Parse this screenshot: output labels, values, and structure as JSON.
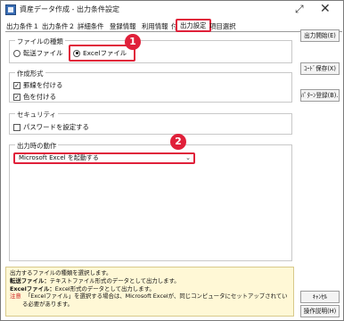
{
  "window": {
    "title": "資産データ作成 - 出力条件設定",
    "expand_glyph": "⤢",
    "close_glyph": "✕"
  },
  "tabs": [
    {
      "label": "出力条件１"
    },
    {
      "label": "出力条件２"
    },
    {
      "label": "詳細条件"
    },
    {
      "label": "登録情報"
    },
    {
      "label": "利用情報"
    },
    {
      "label": "付　箋"
    },
    {
      "label": "出力設定",
      "active": true
    },
    {
      "label": "項目選択"
    }
  ],
  "file_type": {
    "title": "ファイルの種類",
    "options": [
      {
        "label": "転送ファイル",
        "selected": false
      },
      {
        "label": "Excelファイル",
        "selected": true
      }
    ]
  },
  "format": {
    "title": "作成形式",
    "options": [
      {
        "label": "罫線を付ける",
        "checked": true
      },
      {
        "label": "色を付ける",
        "checked": true
      }
    ]
  },
  "security": {
    "title": "セキュリティ",
    "options": [
      {
        "label": "パスワードを設定する",
        "checked": false
      }
    ]
  },
  "post_action": {
    "title": "出力時の動作",
    "selected": "Microsoft Excel を起動する"
  },
  "badges": {
    "one": "1",
    "two": "2"
  },
  "side_buttons": {
    "output_start": "出力開始(E)",
    "code_save": "ｺｰﾄﾞ保存(X)",
    "pattern_register": "ﾊﾟﾀｰﾝ登録(B)...",
    "cancel": "ｷｬﾝｾﾙ",
    "help": "操作説明(H)"
  },
  "help_text": {
    "line1": "出力するファイルの種類を選択します。",
    "line2_label": "転送ファイル：",
    "line2_text": "テキストファイル形式のデータとして出力します。",
    "line3_label": "Excelファイル：",
    "line3_text": "Excel形式のデータとして出力します。",
    "line4_label": "注意",
    "line4_text": "「Excelファイル」を選択する場合は、Microsoft Excelが、同じコンピュータにセットアップされてい",
    "line5_text": "る必要があります。"
  },
  "colors": {
    "highlight": "#e0203a",
    "help_background": "#fff8d6"
  }
}
